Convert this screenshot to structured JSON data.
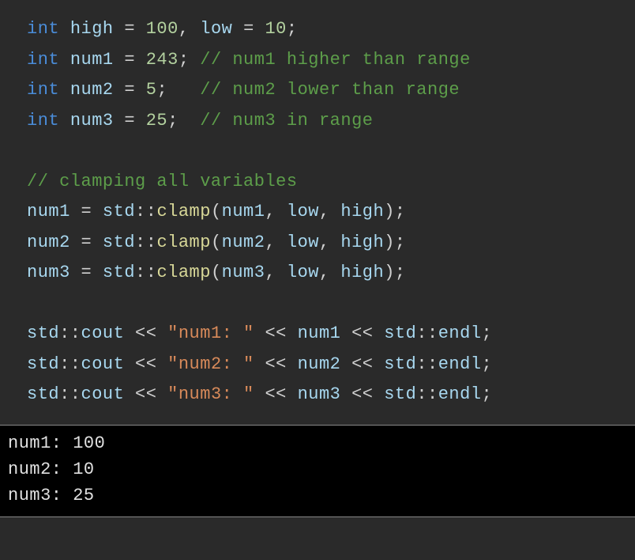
{
  "code": {
    "l1": {
      "kw": "int",
      "sp1": " ",
      "id1": "high",
      "sp2": " ",
      "op1": "=",
      "sp3": " ",
      "num1": "100",
      "op2": ",",
      "sp4": " ",
      "id2": "low",
      "sp5": " ",
      "op3": "=",
      "sp6": " ",
      "num2": "10",
      "op4": ";"
    },
    "l2": {
      "kw": "int",
      "sp1": " ",
      "id1": "num1",
      "sp2": " ",
      "op1": "=",
      "sp3": " ",
      "num1": "243",
      "op2": ";",
      "sp4": " ",
      "cm": "// num1 higher than range"
    },
    "l3": {
      "kw": "int",
      "sp1": " ",
      "id1": "num2",
      "sp2": " ",
      "op1": "=",
      "sp3": " ",
      "num1": "5",
      "op2": ";",
      "sp4": "   ",
      "cm": "// num2 lower than range"
    },
    "l4": {
      "kw": "int",
      "sp1": " ",
      "id1": "num3",
      "sp2": " ",
      "op1": "=",
      "sp3": " ",
      "num1": "25",
      "op2": ";",
      "sp4": "  ",
      "cm": "// num3 in range"
    },
    "l5": {
      "cm": "// clamping all variables"
    },
    "l6": {
      "id1": "num1",
      "sp1": " ",
      "op1": "=",
      "sp2": " ",
      "id2": "std",
      "op2": "::",
      "fn": "clamp",
      "op3": "(",
      "id3": "num1",
      "op4": ",",
      "sp3": " ",
      "id4": "low",
      "op5": ",",
      "sp4": " ",
      "id5": "high",
      "op6": ");"
    },
    "l7": {
      "id1": "num2",
      "sp1": " ",
      "op1": "=",
      "sp2": " ",
      "id2": "std",
      "op2": "::",
      "fn": "clamp",
      "op3": "(",
      "id3": "num2",
      "op4": ",",
      "sp3": " ",
      "id4": "low",
      "op5": ",",
      "sp4": " ",
      "id5": "high",
      "op6": ");"
    },
    "l8": {
      "id1": "num3",
      "sp1": " ",
      "op1": "=",
      "sp2": " ",
      "id2": "std",
      "op2": "::",
      "fn": "clamp",
      "op3": "(",
      "id3": "num3",
      "op4": ",",
      "sp3": " ",
      "id4": "low",
      "op5": ",",
      "sp4": " ",
      "id5": "high",
      "op6": ");"
    },
    "l9": {
      "id1": "std",
      "op1": "::",
      "id2": "cout",
      "sp1": " ",
      "op2": "<<",
      "sp2": " ",
      "str": "\"num1: \"",
      "sp3": " ",
      "op3": "<<",
      "sp4": " ",
      "id3": "num1",
      "sp5": " ",
      "op4": "<<",
      "sp6": " ",
      "id4": "std",
      "op5": "::",
      "id5": "endl",
      "op6": ";"
    },
    "l10": {
      "id1": "std",
      "op1": "::",
      "id2": "cout",
      "sp1": " ",
      "op2": "<<",
      "sp2": " ",
      "str": "\"num2: \"",
      "sp3": " ",
      "op3": "<<",
      "sp4": " ",
      "id3": "num2",
      "sp5": " ",
      "op4": "<<",
      "sp6": " ",
      "id4": "std",
      "op5": "::",
      "id5": "endl",
      "op6": ";"
    },
    "l11": {
      "id1": "std",
      "op1": "::",
      "id2": "cout",
      "sp1": " ",
      "op2": "<<",
      "sp2": " ",
      "str": "\"num3: \"",
      "sp3": " ",
      "op3": "<<",
      "sp4": " ",
      "id3": "num3",
      "sp5": " ",
      "op4": "<<",
      "sp6": " ",
      "id4": "std",
      "op5": "::",
      "id5": "endl",
      "op6": ";"
    }
  },
  "output": {
    "o1": "num1: 100",
    "o2": "num2: 10",
    "o3": "num3: 25"
  }
}
